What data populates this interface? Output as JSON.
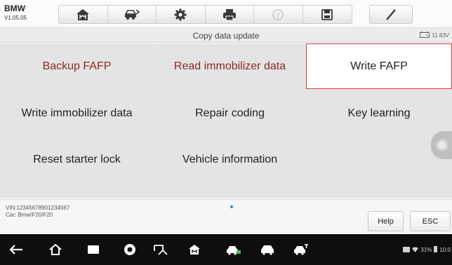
{
  "app": {
    "name": "BMW",
    "version": "V1.05.05"
  },
  "toolbar": {
    "icons": [
      "home-icon",
      "car-swap-icon",
      "settings-gear-icon",
      "printer-icon",
      "help-icon",
      "save-icon",
      "pen-icon"
    ]
  },
  "header": {
    "title": "Copy data update",
    "battery_voltage": "11.83V"
  },
  "grid": {
    "items": [
      {
        "label": "Backup FAFP",
        "color": "#8a2a22"
      },
      {
        "label": "Read immobilizer data",
        "color": "#8a2a22"
      },
      {
        "label": "Write FAFP",
        "selected": true
      },
      {
        "label": "Write immobilizer data"
      },
      {
        "label": "Repair coding"
      },
      {
        "label": "Key learning"
      },
      {
        "label": "Reset starter lock"
      },
      {
        "label": "Vehicle information"
      }
    ]
  },
  "info": {
    "vin": "VIN:12345678901234567",
    "car": "Car: Bmw/F20/F20"
  },
  "buttons": {
    "help": "Help",
    "esc": "ESC"
  },
  "status_bar": {
    "battery": "31%",
    "time": "10:0"
  },
  "colors": {
    "selection": "#e23a3a",
    "accent_text": "#8a2a22",
    "page_dot": "#3a7fd4"
  }
}
